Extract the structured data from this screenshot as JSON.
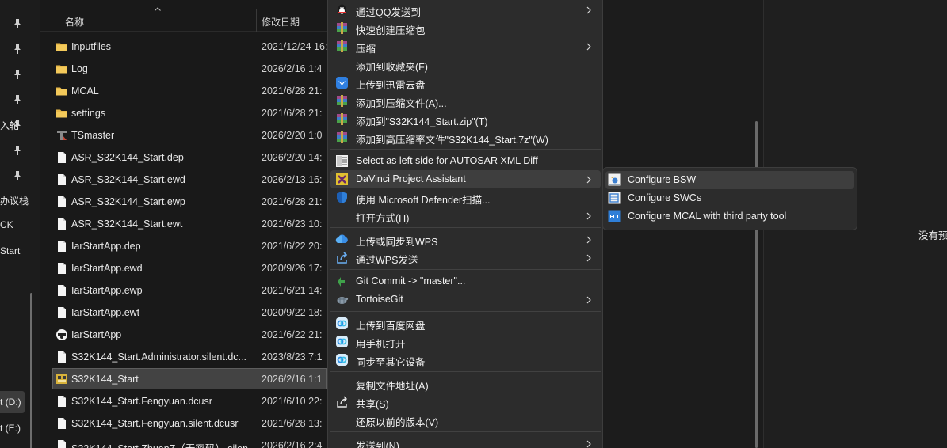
{
  "nav": {
    "fragments": [
      "入轮",
      "办议栈",
      "CK",
      "Start",
      "t (D:)",
      "t (E:)"
    ]
  },
  "file_list": {
    "columns": {
      "name": "名称",
      "date": "修改日期"
    },
    "rows": [
      {
        "icon": "folder-icon",
        "name": "Inputfiles",
        "date": "2021/12/24 16:"
      },
      {
        "icon": "folder-icon",
        "name": "Log",
        "date": "2026/2/16 1:4"
      },
      {
        "icon": "folder-icon",
        "name": "MCAL",
        "date": "2021/6/28 21:"
      },
      {
        "icon": "folder-icon",
        "name": "settings",
        "date": "2021/6/28 21:"
      },
      {
        "icon": "tsmaster-icon",
        "name": "TSmaster",
        "date": "2026/2/20 1:0"
      },
      {
        "icon": "file-icon",
        "name": "ASR_S32K144_Start.dep",
        "date": "2026/2/20 14:"
      },
      {
        "icon": "file-icon",
        "name": "ASR_S32K144_Start.ewd",
        "date": "2026/2/13 16:"
      },
      {
        "icon": "file-icon",
        "name": "ASR_S32K144_Start.ewp",
        "date": "2021/6/28 21:"
      },
      {
        "icon": "file-icon",
        "name": "ASR_S32K144_Start.ewt",
        "date": "2021/6/23 10:"
      },
      {
        "icon": "file-icon",
        "name": "IarStartApp.dep",
        "date": "2021/6/22 20:"
      },
      {
        "icon": "file-icon",
        "name": "IarStartApp.ewd",
        "date": "2020/9/26 17:"
      },
      {
        "icon": "file-icon",
        "name": "IarStartApp.ewp",
        "date": "2021/6/21 14:"
      },
      {
        "icon": "file-icon",
        "name": "IarStartApp.ewt",
        "date": "2020/9/22 18:"
      },
      {
        "icon": "iar-app-icon",
        "name": "IarStartApp",
        "date": "2021/6/22 21:"
      },
      {
        "icon": "file-icon",
        "name": "S32K144_Start.Administrator.silent.dc...",
        "date": "2023/8/23 7:1"
      },
      {
        "icon": "davinci-project-icon",
        "name": "S32K144_Start",
        "date": "2026/2/16 1:1",
        "selected": true
      },
      {
        "icon": "file-icon",
        "name": "S32K144_Start.Fengyuan.dcusr",
        "date": "2021/6/10 22:"
      },
      {
        "icon": "file-icon",
        "name": "S32K144_Start.Fengyuan.silent.dcusr",
        "date": "2021/6/28 13:"
      },
      {
        "icon": "file-icon",
        "name": "S32K144_Start.ZhuanZ（无密码）.silen...",
        "date": "2026/2/16 2:4"
      }
    ]
  },
  "context_menu": {
    "items": [
      {
        "icon": "qq-icon",
        "label": "通过QQ发送到",
        "submenu": true
      },
      {
        "icon": "winrar-icon",
        "label": "快速创建压缩包"
      },
      {
        "icon": "winrar-icon",
        "label": "压缩",
        "submenu": true
      },
      {
        "icon": "",
        "label": "添加到收藏夹(F)"
      },
      {
        "icon": "xunlei-cloud-icon",
        "label": "上传到迅雷云盘"
      },
      {
        "icon": "winrar-icon",
        "label": "添加到压缩文件(A)..."
      },
      {
        "icon": "winrar-icon",
        "label": "添加到\"S32K144_Start.zip\"(T)"
      },
      {
        "icon": "winrar-icon",
        "label": "添加到高压缩率文件\"S32K144_Start.7z\"(W)"
      },
      {
        "separator": true
      },
      {
        "icon": "xml-diff-icon",
        "label": "Select as left side for AUTOSAR XML Diff"
      },
      {
        "icon": "davinci-icon",
        "label": "DaVinci Project Assistant",
        "submenu": true,
        "hover": true
      },
      {
        "icon": "defender-shield-icon",
        "label": "使用 Microsoft Defender扫描..."
      },
      {
        "icon": "",
        "label": "打开方式(H)",
        "submenu": true
      },
      {
        "separator": true
      },
      {
        "icon": "wps-cloud-icon",
        "label": "上传或同步到WPS",
        "submenu": true
      },
      {
        "icon": "wps-share-icon",
        "label": "通过WPS发送",
        "submenu": true
      },
      {
        "separator": true
      },
      {
        "icon": "git-commit-icon",
        "label": "Git Commit -> \"master\"..."
      },
      {
        "icon": "tortoisegit-icon",
        "label": "TortoiseGit",
        "submenu": true
      },
      {
        "separator": true
      },
      {
        "icon": "baidu-netdisk-icon",
        "label": "上传到百度网盘"
      },
      {
        "icon": "baidu-netdisk-icon",
        "label": "用手机打开"
      },
      {
        "icon": "baidu-netdisk-icon",
        "label": "同步至其它设备"
      },
      {
        "separator": true
      },
      {
        "icon": "",
        "label": "复制文件地址(A)"
      },
      {
        "icon": "share-icon",
        "label": "共享(S)"
      },
      {
        "icon": "",
        "label": "还原以前的版本(V)"
      },
      {
        "separator": true
      },
      {
        "icon": "",
        "label": "发送到(N)",
        "submenu": true
      }
    ]
  },
  "submenu": {
    "items": [
      {
        "icon": "configure-bsw-icon",
        "label": "Configure BSW",
        "hover": true
      },
      {
        "icon": "configure-swcs-icon",
        "label": "Configure SWCs"
      },
      {
        "icon": "third-party-icon",
        "label": "Configure MCAL with third party tool"
      }
    ]
  },
  "preview": {
    "text": "没有预"
  },
  "colors": {
    "menu_bg": "#2c2c2c",
    "hover_bg": "#3e3e3e",
    "selected_row_bg": "#434343",
    "folder": "#e8b949",
    "winrar": "#a04a8a",
    "defender": "#2f7fd8"
  }
}
